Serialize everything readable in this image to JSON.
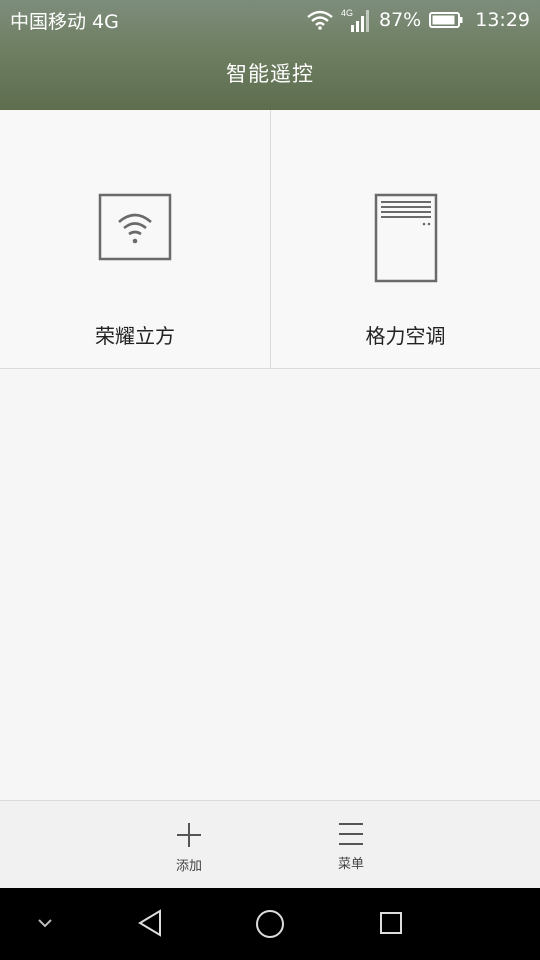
{
  "status_bar": {
    "carrier": "中国移动 4G",
    "network_badge": "4G",
    "battery_percent": "87%",
    "time": "13:29",
    "icons": [
      "wifi-icon",
      "signal-icon",
      "battery-icon"
    ]
  },
  "app_bar": {
    "title": "智能遥控"
  },
  "devices": [
    {
      "label": "荣耀立方",
      "icon": "wifi-box-icon"
    },
    {
      "label": "格力空调",
      "icon": "air-conditioner-icon"
    }
  ],
  "bottom_bar": {
    "add_label": "添加",
    "menu_label": "菜单"
  },
  "nav_bar": {
    "icons": [
      "chevron-down-icon",
      "back-icon",
      "home-icon",
      "recents-icon"
    ]
  },
  "colors": {
    "header_top": "#7d8d7c",
    "header_bottom": "#5d6d4e",
    "background": "#f6f6f6",
    "icon_gray": "#6a6a6a"
  }
}
